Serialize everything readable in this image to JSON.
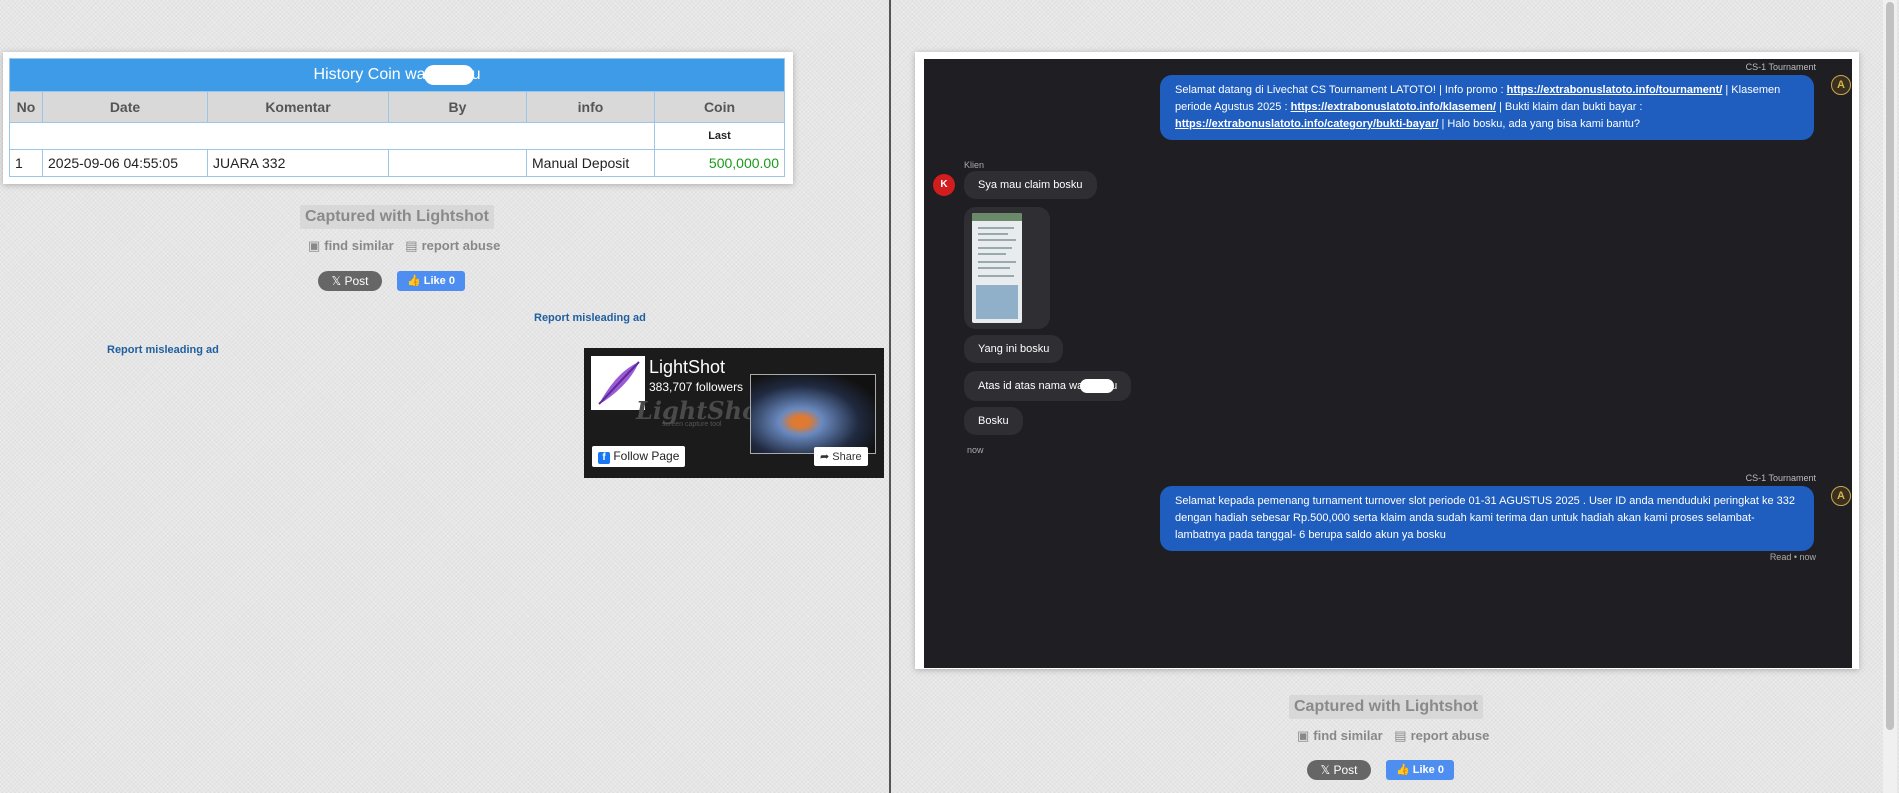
{
  "left": {
    "table": {
      "title_prefix": "History Coin wa",
      "title_suffix": "u",
      "headers": [
        "No",
        "Date",
        "Komentar",
        "By",
        "info",
        "Coin"
      ],
      "sub_label": "Last",
      "rows": [
        {
          "no": "1",
          "date": "2025-09-06 04:55:05",
          "komentar": "JUARA 332",
          "by": "",
          "info": "Manual Deposit",
          "coin": "500,000.00"
        }
      ]
    },
    "captured": "Captured with Lightshot",
    "find_similar": "find similar",
    "report_abuse": "report abuse",
    "post": "Post",
    "like": "Like 0",
    "report_ad_1": "Report misleading ad",
    "report_ad_2": "Report misleading ad",
    "fb_widget": {
      "name": "LightShot",
      "followers": "383,707 followers",
      "watermark": "LightShot",
      "tagline": "screen capture tool",
      "follow": "Follow Page",
      "share": "Share"
    }
  },
  "right": {
    "chat": {
      "agent_name_1": "CS-1 Tournament",
      "msg1_a": "Selamat datang di Livechat CS Tournament LATOTO! | Info promo : ",
      "msg1_link1": "https://extrabonuslatoto.info/tournament/",
      "msg1_b": " | Klasemen periode Agustus 2025 : ",
      "msg1_link2": "https://extrabonuslatoto.info/klasemen/",
      "msg1_c": " | Bukti klaim dan bukti bayar : ",
      "msg1_link3": "https://extrabonuslatoto.info/category/bukti-bayar/",
      "msg1_d": " | Halo bosku, ada yang bisa kami bantu?",
      "client_name": "Klien",
      "client_initial": "K",
      "client_msgs": [
        "Sya mau claim bosku",
        "Yang ini bosku",
        "Atas id atas nama wa",
        "Bosku"
      ],
      "client_msg3_suffix": "u",
      "time_1": "now",
      "agent_name_2": "CS-1 Tournament",
      "msg2": "Selamat kepada pemenang turnament turnover slot periode 01-31 AGUSTUS 2025 . User ID anda menduduki peringkat ke 332 dengan hadiah sebesar Rp.500,000 serta klaim anda sudah kami terima dan untuk hadiah akan kami proses selambat-lambatnya pada tanggal- 6 berupa saldo akun ya bosku",
      "read_status": "Read • now",
      "agent_avatar_letter": "A"
    },
    "captured": "Captured with Lightshot",
    "find_similar": "find similar",
    "report_abuse": "report abuse",
    "post": "Post",
    "like": "Like 0"
  },
  "icons": {
    "camera": "camera-icon",
    "clipboard": "clipboard-icon",
    "x_logo": "x-logo-icon",
    "thumbs_up": "thumbs-up-icon",
    "facebook": "facebook-icon",
    "share": "share-icon"
  }
}
